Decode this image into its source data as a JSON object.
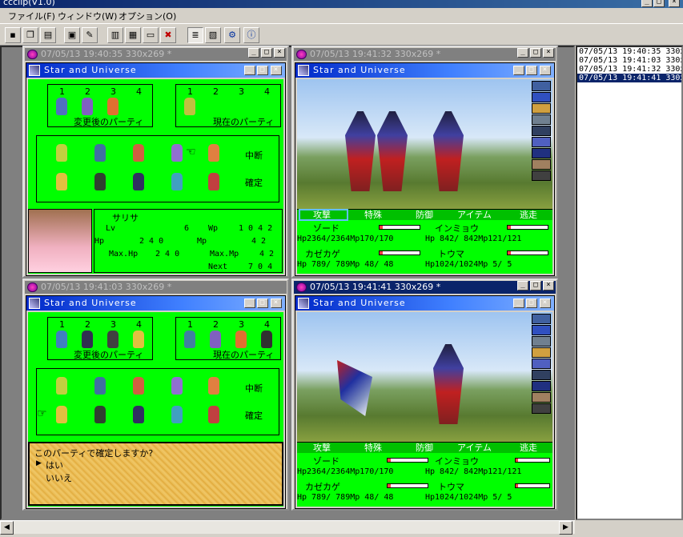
{
  "app": {
    "title": "ccclip(V1.0)"
  },
  "menu": [
    "ファイル(F)",
    "ウィンドウ(W)",
    "オプション(O)"
  ],
  "toolbar": [
    "save-icon",
    "copy-icon",
    "paste-icon",
    "capture-icon",
    "pen-icon",
    "cascade-icon",
    "tile-vertical-icon",
    "tile-horizontal-icon",
    "close-all-icon",
    "list-view-icon",
    "thumbnail-view-icon",
    "settings-icon",
    "info-icon"
  ],
  "history": [
    {
      "label": "07/05/13 19:40:35 330x2",
      "selected": false
    },
    {
      "label": "07/05/13 19:41:03 330x2",
      "selected": false
    },
    {
      "label": "07/05/13 19:41:32 330x2",
      "selected": false
    },
    {
      "label": "07/05/13 19:41:41 330x2",
      "selected": true
    }
  ],
  "windows": [
    {
      "title": "07/05/13 19:40:35 330x269 *",
      "active": false
    },
    {
      "title": "07/05/13 19:41:32 330x269 *",
      "active": false
    },
    {
      "title": "07/05/13 19:41:03 330x269 *",
      "active": false
    },
    {
      "title": "07/05/13 19:41:41 330x269 *",
      "active": true
    }
  ],
  "game": {
    "title": "Star and Universe",
    "slot_numbers": [
      "1",
      "2",
      "3",
      "4"
    ],
    "new_party": "変更後のパーティ",
    "current_party": "現在のパーティ",
    "suspend": "中断",
    "confirm": "確定",
    "char_name": "サリサ",
    "stats": {
      "lv_label": "Lv",
      "lv": "6",
      "wp_label": "Wp",
      "wp": "1 0 4 2",
      "hp_label": "Hp",
      "hp": "2 4 0",
      "mp_label": "Mp",
      "mp": "4 2",
      "maxhp_label": "Max.Hp",
      "maxhp": "2 4 0",
      "maxmp_label": "Max.Mp",
      "maxmp": "4 2",
      "next_label": "Next",
      "next": "7 0 4"
    },
    "dialog_question": "このパーティで確定しますか?",
    "dialog_yes": "はい",
    "dialog_no": "いいえ",
    "commands": [
      "攻撃",
      "特殊",
      "防御",
      "アイテム",
      "逃走"
    ],
    "party": [
      {
        "name": "ゾード",
        "line": "Hp2364/2364Mp170/170",
        "hp": 1.0
      },
      {
        "name": "インミョウ",
        "line": "Hp 842/ 842Mp121/121",
        "hp": 1.0
      },
      {
        "name": "カゼカゲ",
        "line": "Hp 789/ 789Mp 48/ 48",
        "hp": 1.0
      },
      {
        "name": "トウマ",
        "line": "Hp1024/1024Mp  5/  5",
        "hp": 1.0
      }
    ]
  },
  "colors": {
    "game_bg": "#00ff00",
    "active_title": "#0a246a",
    "inactive_title": "#808080"
  }
}
